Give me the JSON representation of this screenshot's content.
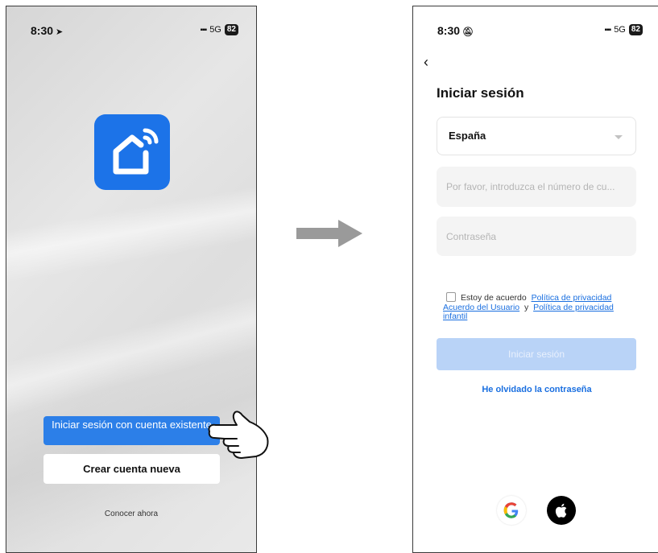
{
  "left_screen": {
    "status": {
      "time": "8:30",
      "network": "5G",
      "battery": "82"
    },
    "login_existing_label": "Iniciar sesión con cuenta existente",
    "create_account_label": "Crear cuenta nueva",
    "learn_more_label": "Conocer ahora",
    "icons": [
      "location-arrow-icon",
      "signal-icon",
      "battery-icon",
      "smart-home-app-icon",
      "pointing-hand-icon"
    ]
  },
  "right_screen": {
    "status": {
      "time": "8:30",
      "network": "5G",
      "battery": "82"
    },
    "title": "Iniciar sesión",
    "country": "España",
    "account_placeholder": "Por favor, introduzca el número de cu...",
    "password_placeholder": "Contraseña",
    "agreement": {
      "prefix": "Estoy de acuerdo",
      "privacy_policy": "Política de privacidad",
      "user_agreement": "Acuerdo del Usuario",
      "conjunction": "y",
      "child_privacy_policy_a": "Política de privacidad",
      "child_privacy_policy_b": "infantil"
    },
    "login_button": "Iniciar sesión",
    "forgot_password": "He olvidado la contraseña",
    "icons": [
      "back-chevron-icon",
      "dropdown-caret-icon",
      "google-icon",
      "apple-icon"
    ]
  },
  "colors": {
    "primary_blue": "#2c7fe8",
    "disabled_blue": "#b9d3f7",
    "link_blue": "#1a6fe0",
    "arrow_gray": "#9a9a9a"
  }
}
